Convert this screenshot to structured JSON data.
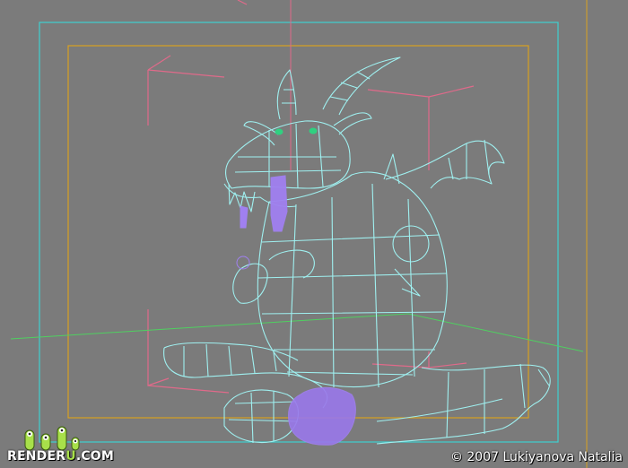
{
  "viewport": {
    "background": "#7b7b7b",
    "colors": {
      "safe_frame_outer": "#3fd0d0",
      "safe_frame_inner": "#d8a020",
      "light_gizmo": "#e06a8a",
      "grid_line": "#4fd060",
      "wireframe": "#9ff0f0",
      "accent_mesh": "#a080f0",
      "eyes": "#30d080"
    }
  },
  "watermark": {
    "logo_prefix": "RENDER",
    "logo_accent": "U",
    "logo_suffix": ".COM",
    "logo_accent_color": "#a8e04a",
    "copyright": "© 2007 Lukiyanova Natalia"
  }
}
